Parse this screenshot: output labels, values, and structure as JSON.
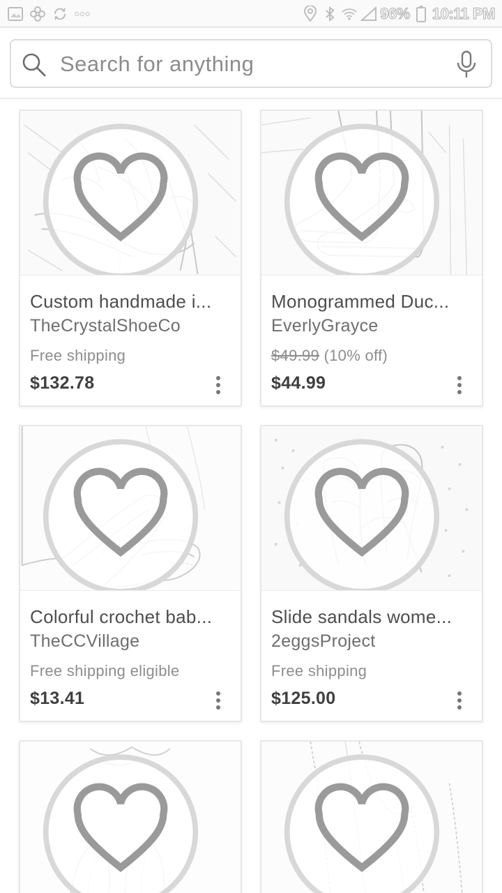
{
  "status_bar": {
    "battery": "96%",
    "time": "10:11 PM",
    "left_icons": [
      "gallery-icon",
      "pinwheel-icon",
      "sync-icon",
      "more-dots-icon"
    ],
    "right_icons": [
      "location-icon",
      "bluetooth-icon",
      "wifi-icon",
      "signal-icon",
      "battery-icon"
    ]
  },
  "search": {
    "placeholder": "Search for anything",
    "value": ""
  },
  "products": [
    {
      "title": "Custom handmade i...",
      "shop": "TheCrystalShoeCo",
      "sub": "Free shipping",
      "original_price": "",
      "discount": "",
      "price": "$132.78",
      "image": "high-heel-sandal"
    },
    {
      "title": "Monogrammed Duc...",
      "shop": "EverlyGrayce",
      "sub": "",
      "original_price": "$49.99",
      "discount": "(10% off)",
      "price": "$44.99",
      "image": "duck-boots"
    },
    {
      "title": "Colorful crochet bab...",
      "shop": "TheCCVillage",
      "sub": "Free shipping eligible",
      "original_price": "",
      "discount": "",
      "price": "$13.41",
      "image": "crochet-booties"
    },
    {
      "title": "Slide sandals wome...",
      "shop": "2eggsProject",
      "sub": "Free shipping",
      "original_price": "",
      "discount": "",
      "price": "$125.00",
      "image": "slide-sandals"
    },
    {
      "title": "",
      "shop": "",
      "sub": "",
      "original_price": "",
      "discount": "",
      "price": "",
      "image": "shoes-partial"
    },
    {
      "title": "",
      "shop": "",
      "sub": "",
      "original_price": "",
      "discount": "",
      "price": "",
      "image": "lace-partial"
    }
  ],
  "colors": {
    "background": "#ffffff",
    "text_primary": "#4d4d4d",
    "text_secondary": "#8d8d8d",
    "border": "#e7e7e7"
  }
}
